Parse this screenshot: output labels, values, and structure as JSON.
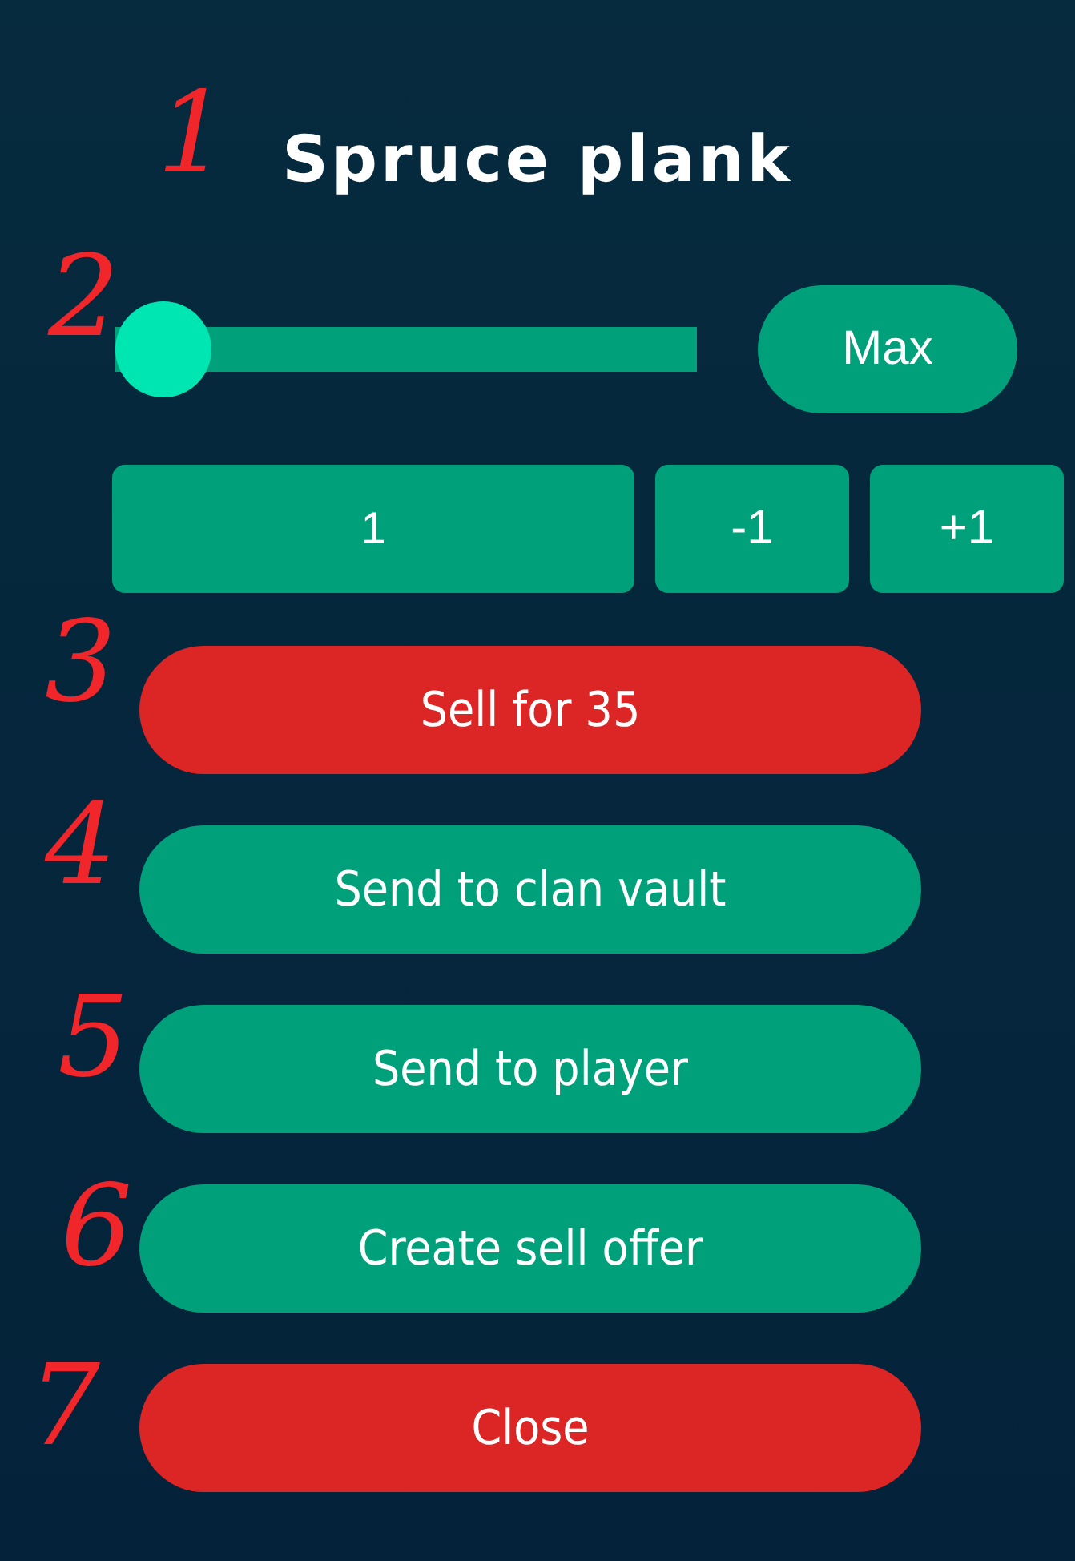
{
  "title": "Spruce plank",
  "slider": {
    "level": 0
  },
  "max_button": "Max",
  "quantity": {
    "value": "1"
  },
  "step_buttons": [
    "-1",
    "+1"
  ],
  "actions": [
    {
      "label": "Sell for 35",
      "kind": "danger"
    },
    {
      "label": "Send to clan vault",
      "kind": "primary"
    },
    {
      "label": "Send to player",
      "kind": "primary"
    },
    {
      "label": "Create sell offer",
      "kind": "primary"
    },
    {
      "label": "Close",
      "kind": "danger"
    }
  ],
  "annotations": [
    "1",
    "2",
    "3",
    "4",
    "5",
    "6",
    "7"
  ]
}
